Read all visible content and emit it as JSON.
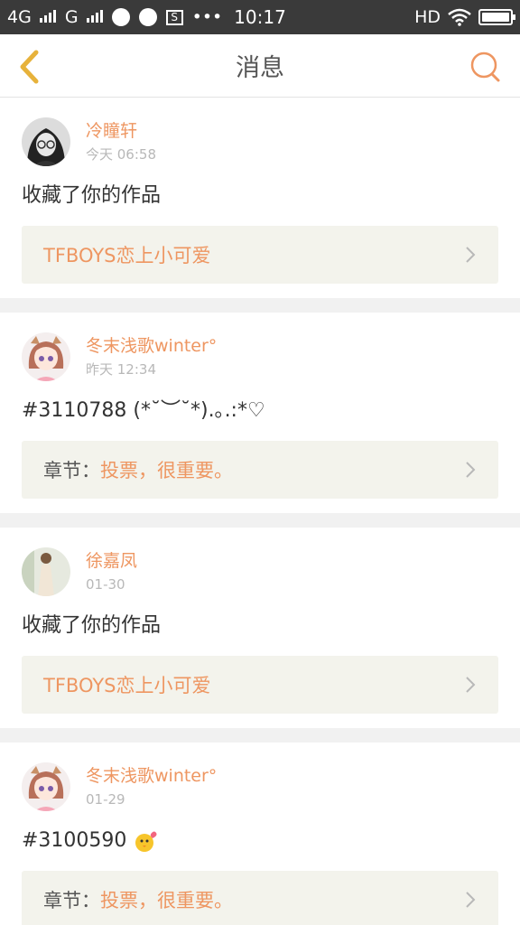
{
  "status_bar": {
    "network1": "4G",
    "network2": "G",
    "more": "•••",
    "time": "10:17",
    "hd": "HD"
  },
  "nav": {
    "title": "消息"
  },
  "messages": [
    {
      "username": "冷瞳轩",
      "time": "今天 06:58",
      "content": "收藏了你的作品",
      "link_prefix": "",
      "link_text": "TFBOYS恋上小可爱"
    },
    {
      "username": "冬末浅歌winter°",
      "time": "昨天 12:34",
      "content": "#3110788 (*˘︶˘*).｡.:*♡",
      "link_prefix": "章节：",
      "link_text": "投票，很重要。"
    },
    {
      "username": "徐嘉凤",
      "time": "01-30",
      "content": "收藏了你的作品",
      "link_prefix": "",
      "link_text": "TFBOYS恋上小可爱"
    },
    {
      "username": "冬末浅歌winter°",
      "time": "01-29",
      "content": "#3100590",
      "link_prefix": "章节：",
      "link_text": "投票，很重要。"
    }
  ],
  "colors": {
    "accent": "#ee9661",
    "back_arrow": "#e7b23b",
    "status_bar_bg": "#3a3a3a",
    "link_bg": "#f3f3ec"
  }
}
